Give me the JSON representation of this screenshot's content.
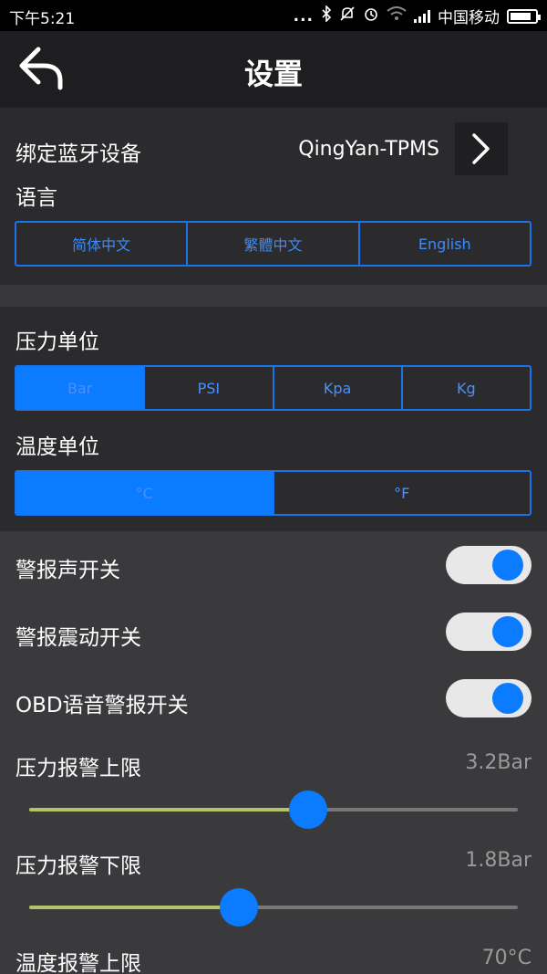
{
  "status_bar": {
    "time": "下午5:21",
    "carrier": "中国移动",
    "dots": "..."
  },
  "header": {
    "title": "设置",
    "back_icon": "back-arrow-icon"
  },
  "bluetooth": {
    "label": "绑定蓝牙设备",
    "device": "QingYan-TPMS"
  },
  "language": {
    "label": "语言",
    "options": [
      "简体中文",
      "繁體中文",
      "English"
    ]
  },
  "pressure_unit": {
    "label": "压力单位",
    "options": [
      "Bar",
      "PSI",
      "Kpa",
      "Kg"
    ],
    "selected": "Bar"
  },
  "temp_unit": {
    "label": "温度单位",
    "options": [
      "°C",
      "°F"
    ],
    "selected": "°C"
  },
  "switches": [
    {
      "label": "警报声开关",
      "on": true
    },
    {
      "label": "警报震动开关",
      "on": true
    },
    {
      "label": "OBD语音警报开关",
      "on": true
    }
  ],
  "sliders": [
    {
      "label": "压力报警上限",
      "value": "3.2Bar",
      "fraction": 0.57
    },
    {
      "label": "压力报警下限",
      "value": "1.8Bar",
      "fraction": 0.43
    },
    {
      "label": "温度报警上限",
      "value": "70°C"
    }
  ],
  "colors": {
    "accent": "#0b7bff",
    "track_fill": "#b7c06a",
    "background": "#2b2b2e"
  }
}
